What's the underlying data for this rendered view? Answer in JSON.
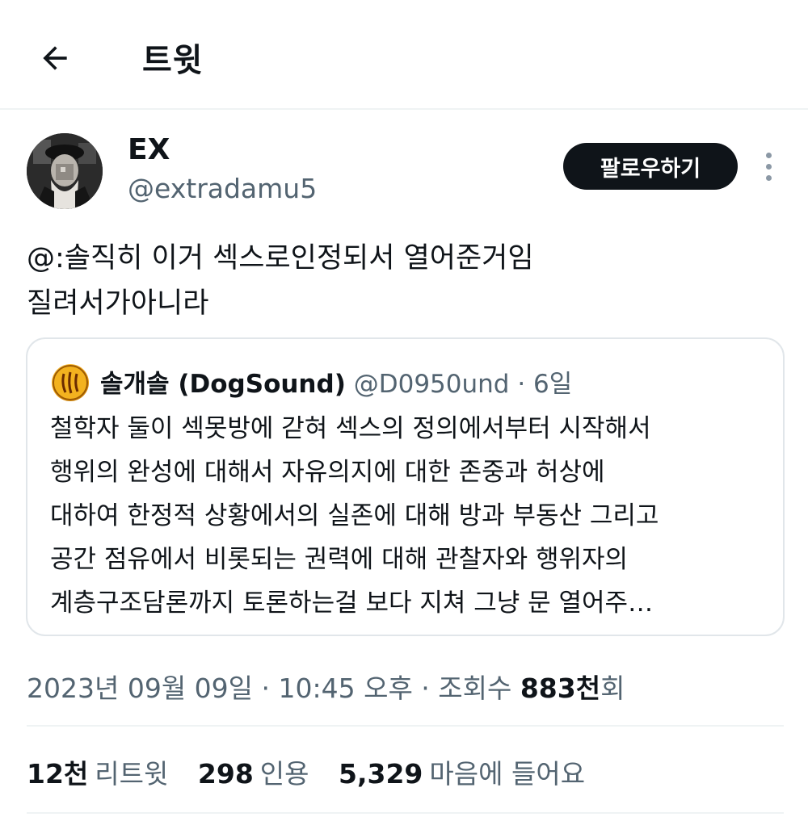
{
  "header": {
    "title": "트윗",
    "back_icon": "arrow-left-icon"
  },
  "tweet": {
    "display_name": "EX",
    "handle": "@extradamu5",
    "follow_label": "팔로우하기",
    "more_icon": "more-vertical-icon",
    "text": "@:솔직히 이거 섹스로인정되서 열어준거임\n질려서가아니라"
  },
  "quote": {
    "name": "솔개솔 (DogSound)",
    "meta": " @D0950und · 6일",
    "text": "철학자 둘이 섹못방에 갇혀 섹스의 정의에서부터 시작해서\n행위의 완성에 대해서 자유의지에 대한 존중과 허상에\n대하여 한정적 상황에서의 실존에 대해 방과 부동산 그리고\n공간 점유에서 비롯되는 권력에 대해 관찰자와 행위자의\n계층구조담론까지 토론하는걸 보다 지쳐 그냥 문 열어주…"
  },
  "timestamp": {
    "date_time": "2023년 09월 09일 · 10:45 오후 · 조회수 ",
    "views": "883천",
    "views_suffix": "회"
  },
  "stats": {
    "retweets_count": "12천",
    "retweets_label": "리트윗",
    "quotes_count": "298",
    "quotes_label": "인용",
    "likes_count": "5,329",
    "likes_label": "마음에 들어요"
  },
  "colors": {
    "text_primary": "#0f1419",
    "text_secondary": "#536471",
    "divider": "#eff3f4",
    "follow_button_bg": "#0f1419"
  }
}
